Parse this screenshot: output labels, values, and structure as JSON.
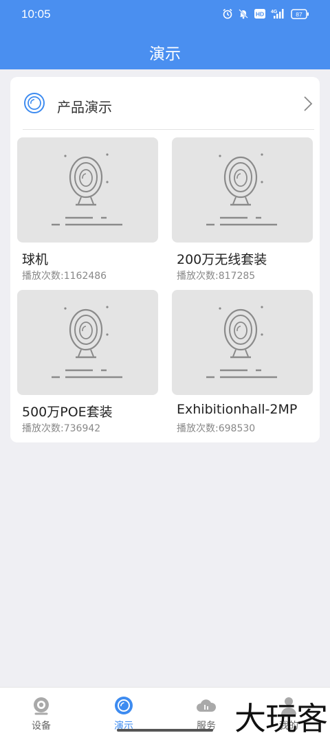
{
  "status_bar": {
    "time": "10:05",
    "icons": [
      "alarm-icon",
      "bell-off-icon",
      "hd-icon",
      "signal-4g-icon"
    ],
    "hd_label": "HD",
    "network_label": "4G",
    "battery": "87"
  },
  "header": {
    "title": "演示"
  },
  "section": {
    "title": "产品演示",
    "icon": "demo-lens-icon"
  },
  "items": [
    {
      "title": "球机",
      "views": "播放次数:1162486"
    },
    {
      "title": "200万无线套装",
      "views": "播放次数:817285"
    },
    {
      "title": "500万POE套装",
      "views": "播放次数:736942"
    },
    {
      "title": "Exhibitionhall-2MP",
      "views": "播放次数:698530"
    }
  ],
  "tabbar": {
    "tabs": [
      {
        "label": "设备",
        "icon": "camera-icon"
      },
      {
        "label": "演示",
        "icon": "demo-icon",
        "active": true
      },
      {
        "label": "服务",
        "icon": "cloud-service-icon"
      },
      {
        "label": "我的",
        "icon": "profile-icon"
      }
    ]
  },
  "watermark": "大玩客",
  "colors": {
    "primary": "#4a8ff0",
    "active_tab": "#3d8bf0",
    "background": "#efeff3"
  }
}
